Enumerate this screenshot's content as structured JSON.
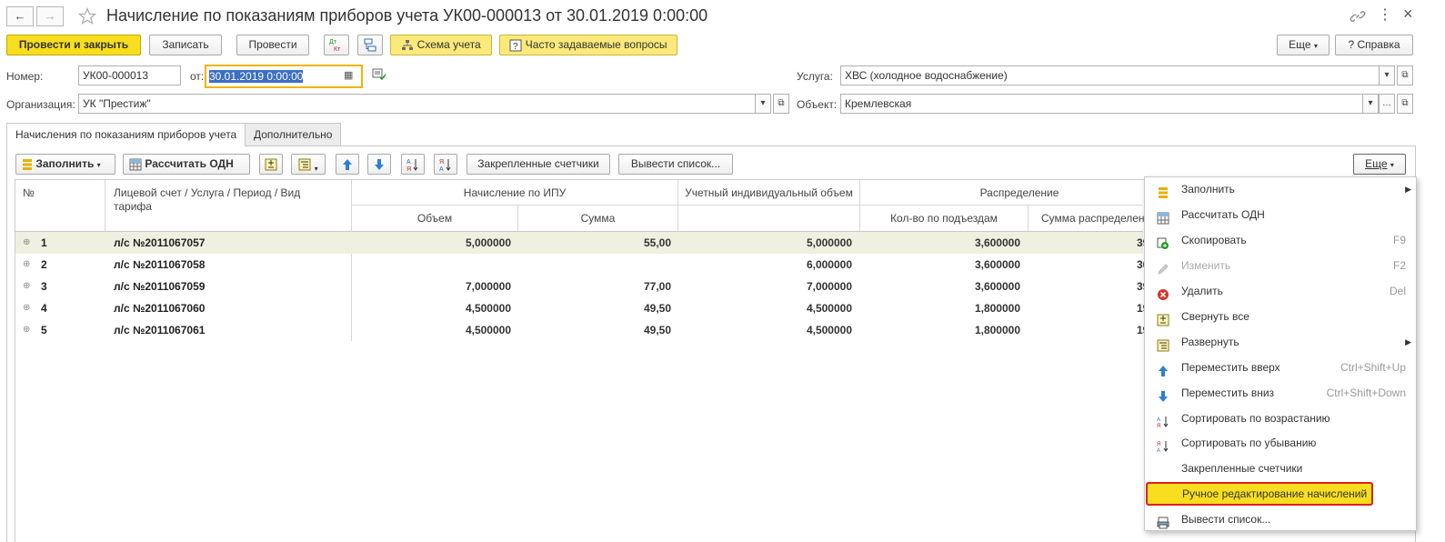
{
  "window": {
    "title": "Начисление по показаниям приборов учета УК00-000013 от 30.01.2019 0:00:00"
  },
  "toolbar": {
    "post_close": "Провести и закрыть",
    "save": "Записать",
    "post": "Провести",
    "scheme": "Схема учета",
    "faq": "Часто задаваемые вопросы",
    "more": "Еще",
    "help": "Справка",
    "dt_kt": "Дт Кт"
  },
  "form": {
    "number_label": "Номер:",
    "number_value": "УК00-000013",
    "date_label": "от:",
    "date_value": "30.01.2019  0:00:00",
    "service_label": "Услуга:",
    "service_value": "ХВС (холодное водоснабжение)",
    "org_label": "Организация:",
    "org_value": "УК \"Престиж\"",
    "object_label": "Объект:",
    "object_value": "Кремлевская"
  },
  "tabs": [
    {
      "label": "Начисления по показаниям приборов учета"
    },
    {
      "label": "Дополнительно"
    }
  ],
  "table_toolbar": {
    "fill": "Заполнить",
    "calc_odn": "Рассчитать ОДН",
    "pinned": "Закрепленные счетчики",
    "export": "Вывести список...",
    "more": "Еще"
  },
  "table": {
    "headers": {
      "num": "№",
      "account": "Лицевой счет / Услуга / Период / Вид тарифа",
      "ipu": "Начисление по ИПУ",
      "volume": "Объем",
      "sum": "Сумма",
      "individual": "Учетный индивидуальный объем",
      "distribution": "Распределение",
      "entrances": "Кол-во по подъездам",
      "dist_sum": "Сумма распределен"
    },
    "rows": [
      {
        "n": "1",
        "account": "л/с №2011067057",
        "volume": "5,000000",
        "sum": "55,00",
        "individual": "5,000000",
        "entrances": "3,600000",
        "dist": "39"
      },
      {
        "n": "2",
        "account": "л/с №2011067058",
        "volume": "",
        "sum": "",
        "individual": "6,000000",
        "entrances": "3,600000",
        "dist": "30"
      },
      {
        "n": "3",
        "account": "л/с №2011067059",
        "volume": "7,000000",
        "sum": "77,00",
        "individual": "7,000000",
        "entrances": "3,600000",
        "dist": "39"
      },
      {
        "n": "4",
        "account": "л/с №2011067060",
        "volume": "4,500000",
        "sum": "49,50",
        "individual": "4,500000",
        "entrances": "1,800000",
        "dist": "19"
      },
      {
        "n": "5",
        "account": "л/с №2011067061",
        "volume": "4,500000",
        "sum": "49,50",
        "individual": "4,500000",
        "entrances": "1,800000",
        "dist": "19"
      }
    ]
  },
  "menu": {
    "items": [
      {
        "label": "Заполнить",
        "shortcut": "",
        "submenu": true
      },
      {
        "label": "Рассчитать ОДН",
        "shortcut": ""
      },
      {
        "label": "Скопировать",
        "shortcut": "F9"
      },
      {
        "label": "Изменить",
        "shortcut": "F2"
      },
      {
        "label": "Удалить",
        "shortcut": "Del"
      },
      {
        "label": "Свернуть все",
        "shortcut": ""
      },
      {
        "label": "Развернуть",
        "shortcut": "",
        "submenu": true
      },
      {
        "label": "Переместить вверх",
        "shortcut": "Ctrl+Shift+Up"
      },
      {
        "label": "Переместить вниз",
        "shortcut": "Ctrl+Shift+Down"
      },
      {
        "label": "Сортировать по возрастанию",
        "shortcut": ""
      },
      {
        "label": "Сортировать по убыванию",
        "shortcut": ""
      },
      {
        "label": "Закрепленные счетчики",
        "shortcut": ""
      },
      {
        "label": "Ручное редактирование начислений",
        "shortcut": ""
      },
      {
        "label": "Вывести список...",
        "shortcut": ""
      }
    ]
  },
  "colors": {
    "accent_yellow": "#f8de1e",
    "selected_row": "#f0f0e1",
    "highlight_border": "#e02020",
    "arrow_blue": "#2b7fd6",
    "delete_red": "#d9342b"
  }
}
